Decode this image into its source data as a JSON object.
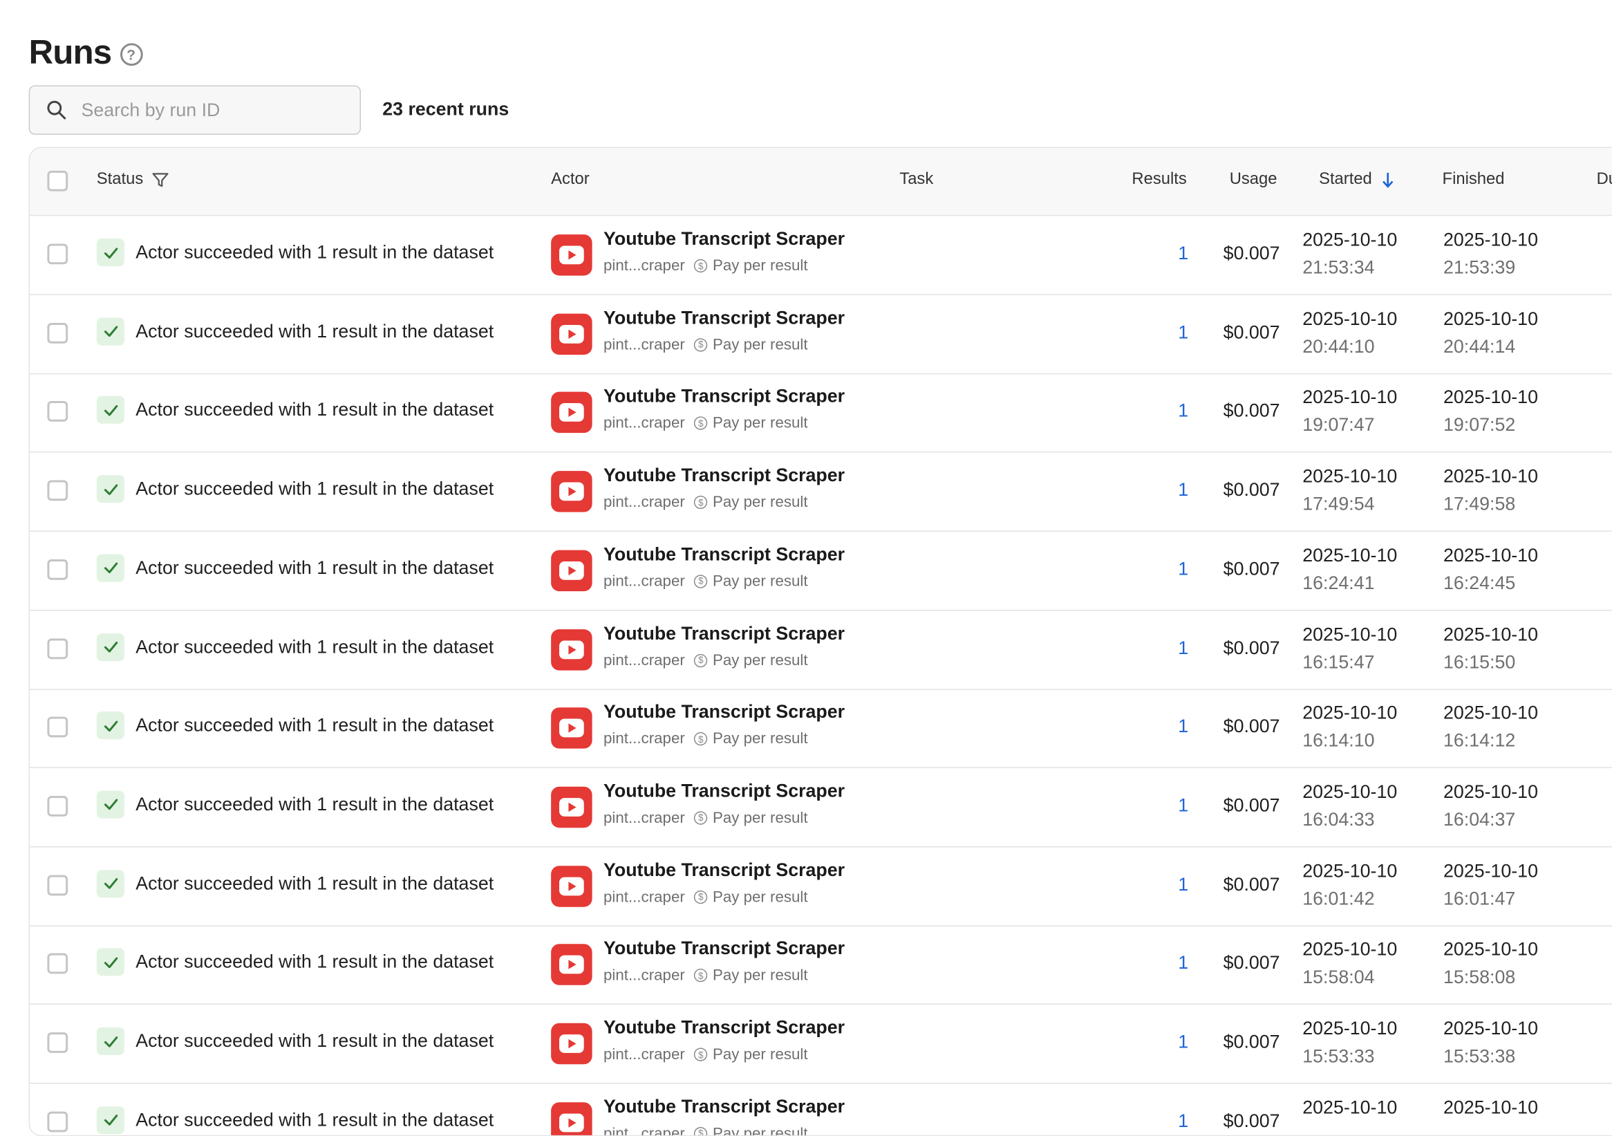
{
  "page": {
    "title": "Runs",
    "help_icon": "question-icon",
    "search": {
      "placeholder": "Search by run ID",
      "value": ""
    },
    "run_count": "23 recent runs"
  },
  "table": {
    "headers": {
      "status": "Status",
      "actor": "Actor",
      "task": "Task",
      "results": "Results",
      "usage": "Usage",
      "started": "Started",
      "finished": "Finished",
      "duration": "Du"
    },
    "rows": [
      {
        "status": "Actor succeeded with 1 result in the dataset",
        "actor": "Youtube Transcript Scraper",
        "actor_id": "pint...craper",
        "pricing": "Pay per result",
        "task": "",
        "results": "1",
        "usage": "$0.007",
        "started_date": "2025-10-10",
        "started_time": "21:53:34",
        "finished_date": "2025-10-10",
        "finished_time": "21:53:39"
      },
      {
        "status": "Actor succeeded with 1 result in the dataset",
        "actor": "Youtube Transcript Scraper",
        "actor_id": "pint...craper",
        "pricing": "Pay per result",
        "task": "",
        "results": "1",
        "usage": "$0.007",
        "started_date": "2025-10-10",
        "started_time": "20:44:10",
        "finished_date": "2025-10-10",
        "finished_time": "20:44:14"
      },
      {
        "status": "Actor succeeded with 1 result in the dataset",
        "actor": "Youtube Transcript Scraper",
        "actor_id": "pint...craper",
        "pricing": "Pay per result",
        "task": "",
        "results": "1",
        "usage": "$0.007",
        "started_date": "2025-10-10",
        "started_time": "19:07:47",
        "finished_date": "2025-10-10",
        "finished_time": "19:07:52"
      },
      {
        "status": "Actor succeeded with 1 result in the dataset",
        "actor": "Youtube Transcript Scraper",
        "actor_id": "pint...craper",
        "pricing": "Pay per result",
        "task": "",
        "results": "1",
        "usage": "$0.007",
        "started_date": "2025-10-10",
        "started_time": "17:49:54",
        "finished_date": "2025-10-10",
        "finished_time": "17:49:58"
      },
      {
        "status": "Actor succeeded with 1 result in the dataset",
        "actor": "Youtube Transcript Scraper",
        "actor_id": "pint...craper",
        "pricing": "Pay per result",
        "task": "",
        "results": "1",
        "usage": "$0.007",
        "started_date": "2025-10-10",
        "started_time": "16:24:41",
        "finished_date": "2025-10-10",
        "finished_time": "16:24:45"
      },
      {
        "status": "Actor succeeded with 1 result in the dataset",
        "actor": "Youtube Transcript Scraper",
        "actor_id": "pint...craper",
        "pricing": "Pay per result",
        "task": "",
        "results": "1",
        "usage": "$0.007",
        "started_date": "2025-10-10",
        "started_time": "16:15:47",
        "finished_date": "2025-10-10",
        "finished_time": "16:15:50"
      },
      {
        "status": "Actor succeeded with 1 result in the dataset",
        "actor": "Youtube Transcript Scraper",
        "actor_id": "pint...craper",
        "pricing": "Pay per result",
        "task": "",
        "results": "1",
        "usage": "$0.007",
        "started_date": "2025-10-10",
        "started_time": "16:14:10",
        "finished_date": "2025-10-10",
        "finished_time": "16:14:12"
      },
      {
        "status": "Actor succeeded with 1 result in the dataset",
        "actor": "Youtube Transcript Scraper",
        "actor_id": "pint...craper",
        "pricing": "Pay per result",
        "task": "",
        "results": "1",
        "usage": "$0.007",
        "started_date": "2025-10-10",
        "started_time": "16:04:33",
        "finished_date": "2025-10-10",
        "finished_time": "16:04:37"
      },
      {
        "status": "Actor succeeded with 1 result in the dataset",
        "actor": "Youtube Transcript Scraper",
        "actor_id": "pint...craper",
        "pricing": "Pay per result",
        "task": "",
        "results": "1",
        "usage": "$0.007",
        "started_date": "2025-10-10",
        "started_time": "16:01:42",
        "finished_date": "2025-10-10",
        "finished_time": "16:01:47"
      },
      {
        "status": "Actor succeeded with 1 result in the dataset",
        "actor": "Youtube Transcript Scraper",
        "actor_id": "pint...craper",
        "pricing": "Pay per result",
        "task": "",
        "results": "1",
        "usage": "$0.007",
        "started_date": "2025-10-10",
        "started_time": "15:58:04",
        "finished_date": "2025-10-10",
        "finished_time": "15:58:08"
      },
      {
        "status": "Actor succeeded with 1 result in the dataset",
        "actor": "Youtube Transcript Scraper",
        "actor_id": "pint...craper",
        "pricing": "Pay per result",
        "task": "",
        "results": "1",
        "usage": "$0.007",
        "started_date": "2025-10-10",
        "started_time": "15:53:33",
        "finished_date": "2025-10-10",
        "finished_time": "15:53:38"
      },
      {
        "status": "Actor succeeded with 1 result in the dataset",
        "actor": "Youtube Transcript Scraper",
        "actor_id": "pint...craper",
        "pricing": "Pay per result",
        "task": "",
        "results": "1",
        "usage": "$0.007",
        "started_date": "2025-10-10",
        "started_time": "",
        "finished_date": "2025-10-10",
        "finished_time": ""
      }
    ]
  },
  "colors": {
    "link": "#1d64d8",
    "success_bg": "#e3f3e3",
    "success_check": "#2e7d32",
    "youtube_red": "#e53935"
  }
}
